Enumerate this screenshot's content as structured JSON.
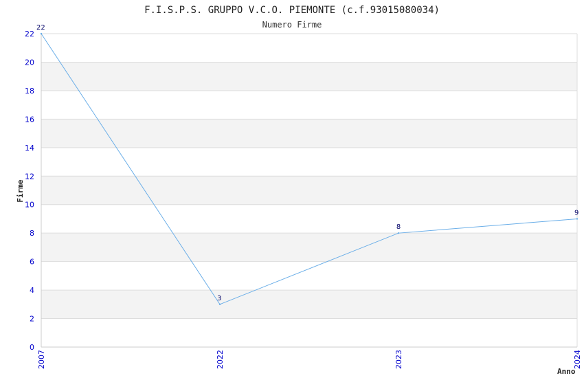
{
  "chart_data": {
    "type": "line",
    "title": "F.I.S.P.S. GRUPPO V.C.O. PIEMONTE (c.f.93015080034)",
    "subtitle": "Numero Firme",
    "xlabel": "Anno",
    "ylabel": "Firme",
    "categories": [
      "2007",
      "2022",
      "2023",
      "2024"
    ],
    "values": [
      22,
      3,
      8,
      9
    ],
    "data_labels": [
      "22",
      "3",
      "8",
      "9"
    ],
    "yticks": [
      "0",
      "2",
      "4",
      "6",
      "8",
      "10",
      "12",
      "14",
      "16",
      "18",
      "20",
      "22"
    ],
    "ylim": [
      0,
      22
    ],
    "grid": true,
    "colors": {
      "line": "#6aaee8",
      "band": "#f3f3f3",
      "grid": "#dddddd",
      "tick_text": "#0000cc",
      "point_text": "#000066"
    }
  }
}
